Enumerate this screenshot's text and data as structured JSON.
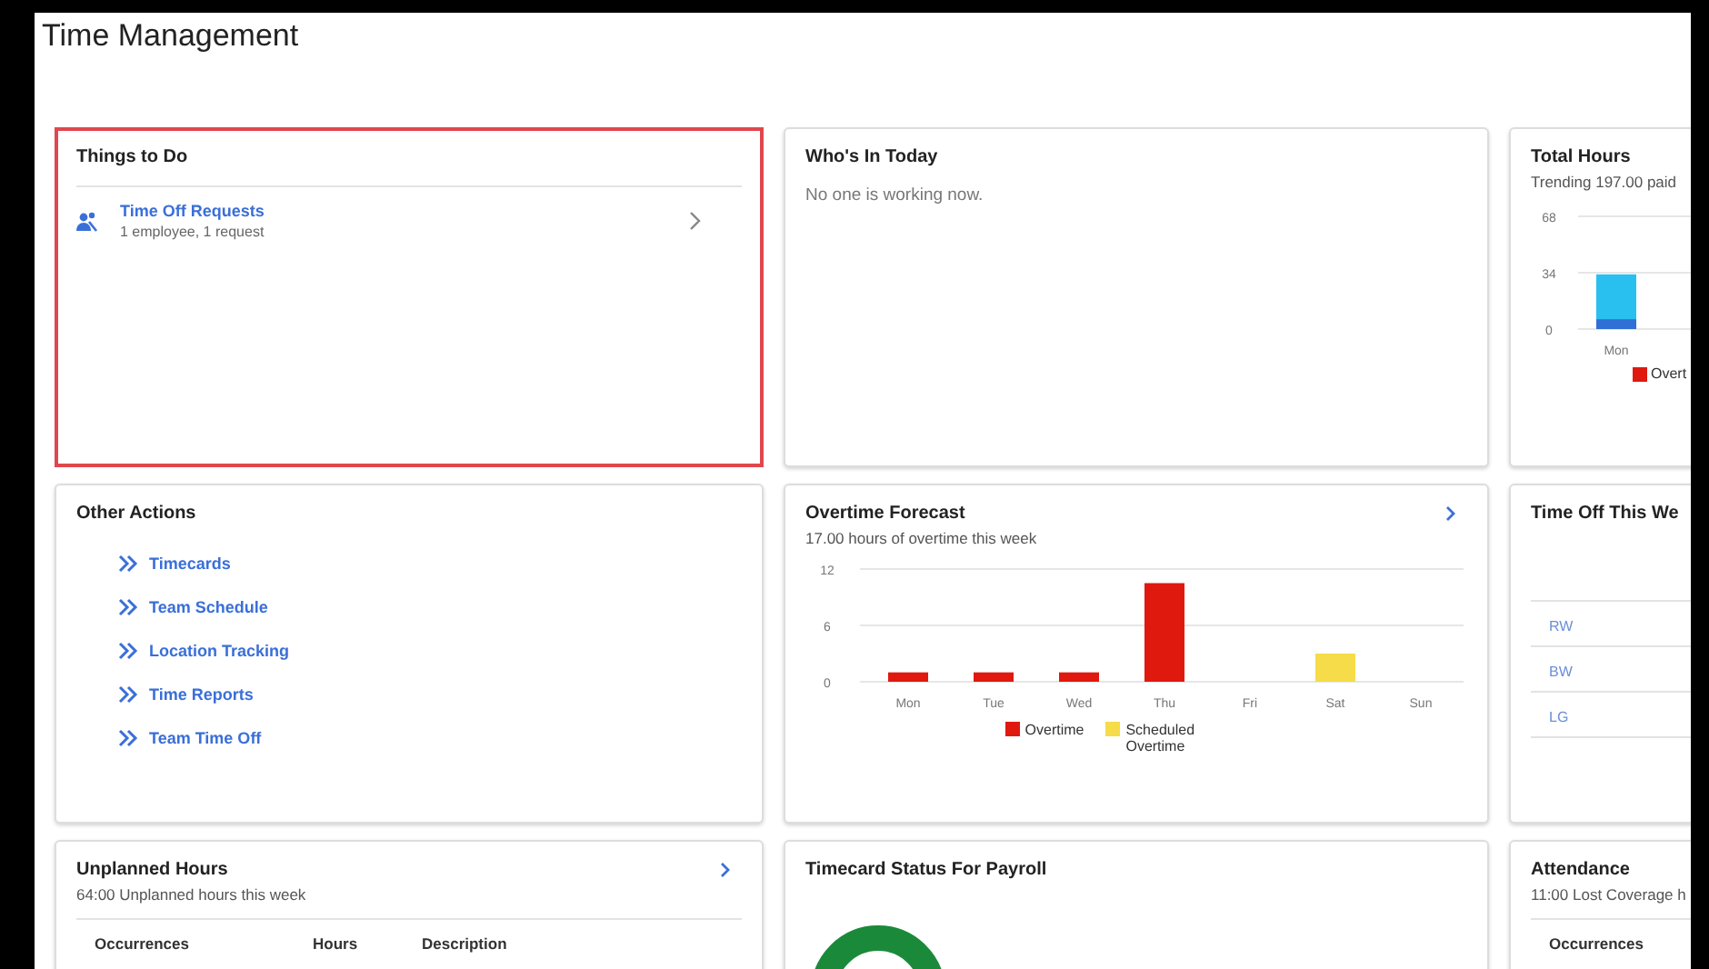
{
  "title": "Time Management",
  "cards": [
    {
      "kind": "todo",
      "title": "Things to Do",
      "highlighted": true,
      "items": [
        {
          "label": "Time Off Requests",
          "detail": "1 employee, 1 request"
        }
      ]
    },
    {
      "kind": "message",
      "title": "Who's In Today",
      "message": "No one is working now."
    },
    {
      "kind": "total_hours",
      "title": "Total Hours",
      "subtitle": "Trending 197.00 paid",
      "chart_data": {
        "type": "bar",
        "stacked": true,
        "categories": [
          "Mon"
        ],
        "yticks": [
          0,
          34,
          68
        ],
        "ylim": [
          0,
          68
        ],
        "series": [
          {
            "color": "#2f6fd6",
            "values": [
              6
            ]
          },
          {
            "color": "#29c0f0",
            "values": [
              27
            ]
          },
          {
            "name": "Overt",
            "color": "#e0190f",
            "values": [
              0
            ]
          }
        ]
      }
    },
    {
      "kind": "actions",
      "title": "Other Actions",
      "links": [
        "Timecards",
        "Team Schedule",
        "Location Tracking",
        "Time Reports",
        "Team Time Off"
      ]
    },
    {
      "kind": "forecast",
      "title": "Overtime Forecast",
      "subtitle": "17.00 hours of overtime this week",
      "chart_data": {
        "type": "bar",
        "stacked": true,
        "categories": [
          "Mon",
          "Tue",
          "Wed",
          "Thu",
          "Fri",
          "Sat",
          "Sun"
        ],
        "yticks": [
          0,
          6,
          12
        ],
        "ylim": [
          0,
          12
        ],
        "series": [
          {
            "name": "Overtime",
            "color": "#e0190f",
            "values": [
              1,
              1,
              1,
              10.5,
              0,
              0,
              0
            ]
          },
          {
            "name": "Scheduled Overtime",
            "color": "#f5dc48",
            "values": [
              0,
              0,
              0,
              0,
              0,
              3,
              0
            ]
          }
        ]
      }
    },
    {
      "kind": "time_off",
      "title": "Time Off This We",
      "rows": [
        "RW",
        "BW",
        "LG"
      ]
    },
    {
      "kind": "unplanned",
      "title": "Unplanned Hours",
      "subtitle": "64:00 Unplanned hours this week",
      "columns": [
        "Occurrences",
        "Hours",
        "Description"
      ]
    },
    {
      "kind": "timecard_status",
      "title": "Timecard Status For Payroll"
    },
    {
      "kind": "attendance",
      "title": "Attendance",
      "subtitle": "11:00 Lost Coverage h",
      "columns": [
        "Occurrences"
      ]
    }
  ]
}
